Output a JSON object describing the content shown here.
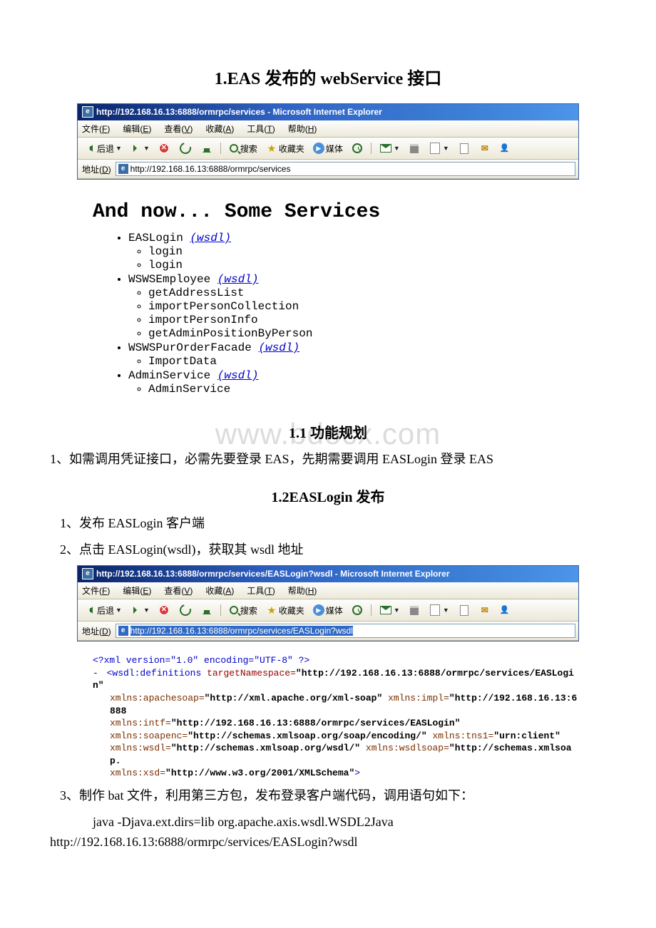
{
  "title_main": "1.EAS 发布的 webService 接口",
  "ie1": {
    "title": "http://192.168.16.13:6888/ormrpc/services - Microsoft Internet Explorer",
    "address": "http://192.168.16.13:6888/ormrpc/services"
  },
  "ie2": {
    "title": "http://192.168.16.13:6888/ormrpc/services/EASLogin?wsdl - Microsoft Internet Explorer",
    "address": "http://192.168.16.13:6888/ormrpc/services/EASLogin?wsdl"
  },
  "menus": {
    "file": "文件(F)",
    "edit": "编辑(E)",
    "view": "查看(V)",
    "fav": "收藏(A)",
    "tools": "工具(T)",
    "help": "帮助(H)"
  },
  "toolbar": {
    "back": "后退",
    "search": "搜索",
    "favorites": "收藏夹",
    "media": "媒体",
    "address_label": "地址(D)"
  },
  "services_heading": "And now... Some Services",
  "wsdl_label": "(wsdl)",
  "services": [
    {
      "name": "EASLogin",
      "ops": [
        "login",
        "login"
      ]
    },
    {
      "name": "WSWSEmployee",
      "ops": [
        "getAddressList",
        "importPersonCollection",
        "importPersonInfo",
        "getAdminPositionByPerson"
      ]
    },
    {
      "name": "WSWSPurOrderFacade",
      "ops": [
        "ImportData"
      ]
    },
    {
      "name": "AdminService",
      "ops": [
        "AdminService"
      ]
    }
  ],
  "watermark": "www.bdocx.com",
  "h_1_1": "1.1 功能规划",
  "p_1_1": "1、如需调用凭证接口，必需先要登录 EAS，先期需要调用 EASLogin 登录 EAS",
  "h_1_2": "1.2EASLogin 发布",
  "p_1_2a": "1、发布 EASLogin 客户端",
  "p_1_2b": "2、点击 EASLogin(wsdl)，获取其 wsdl 地址",
  "xml": {
    "decl": "<?xml version=\"1.0\" encoding=\"UTF-8\" ?>",
    "open": "<wsdl:definitions",
    "tns_attr": "targetNamespace=",
    "tns_val": "\"http://192.168.16.13:6888/ormrpc/services/EASLogin\"",
    "a1n": "xmlns:apachesoap=",
    "a1v": "\"http://xml.apache.org/xml-soap\"",
    "a2n": "xmlns:impl=",
    "a2v": "\"http://192.168.16.13:6888",
    "a3n": "xmlns:intf=",
    "a3v": "\"http://192.168.16.13:6888/ormrpc/services/EASLogin\"",
    "a4n": "xmlns:soapenc=",
    "a4v": "\"http://schemas.xmlsoap.org/soap/encoding/\"",
    "a5n": "xmlns:tns1=",
    "a5v": "\"urn:client\"",
    "a6n": "xmlns:wsdl=",
    "a6v": "\"http://schemas.xmlsoap.org/wsdl/\"",
    "a7n": "xmlns:wsdlsoap=",
    "a7v": "\"http://schemas.xmlsoap.",
    "a8n": "xmlns:xsd=",
    "a8v": "\"http://www.w3.org/2001/XMLSchema\"",
    "close": ">"
  },
  "p_1_2c": "3、制作 bat 文件，利用第三方包，发布登录客户端代码，调用语句如下：",
  "cmd1": "java -Djava.ext.dirs=lib org.apache.axis.wsdl.WSDL2Java",
  "cmd2": "http://192.168.16.13:6888/ormrpc/services/EASLogin?wsdl"
}
